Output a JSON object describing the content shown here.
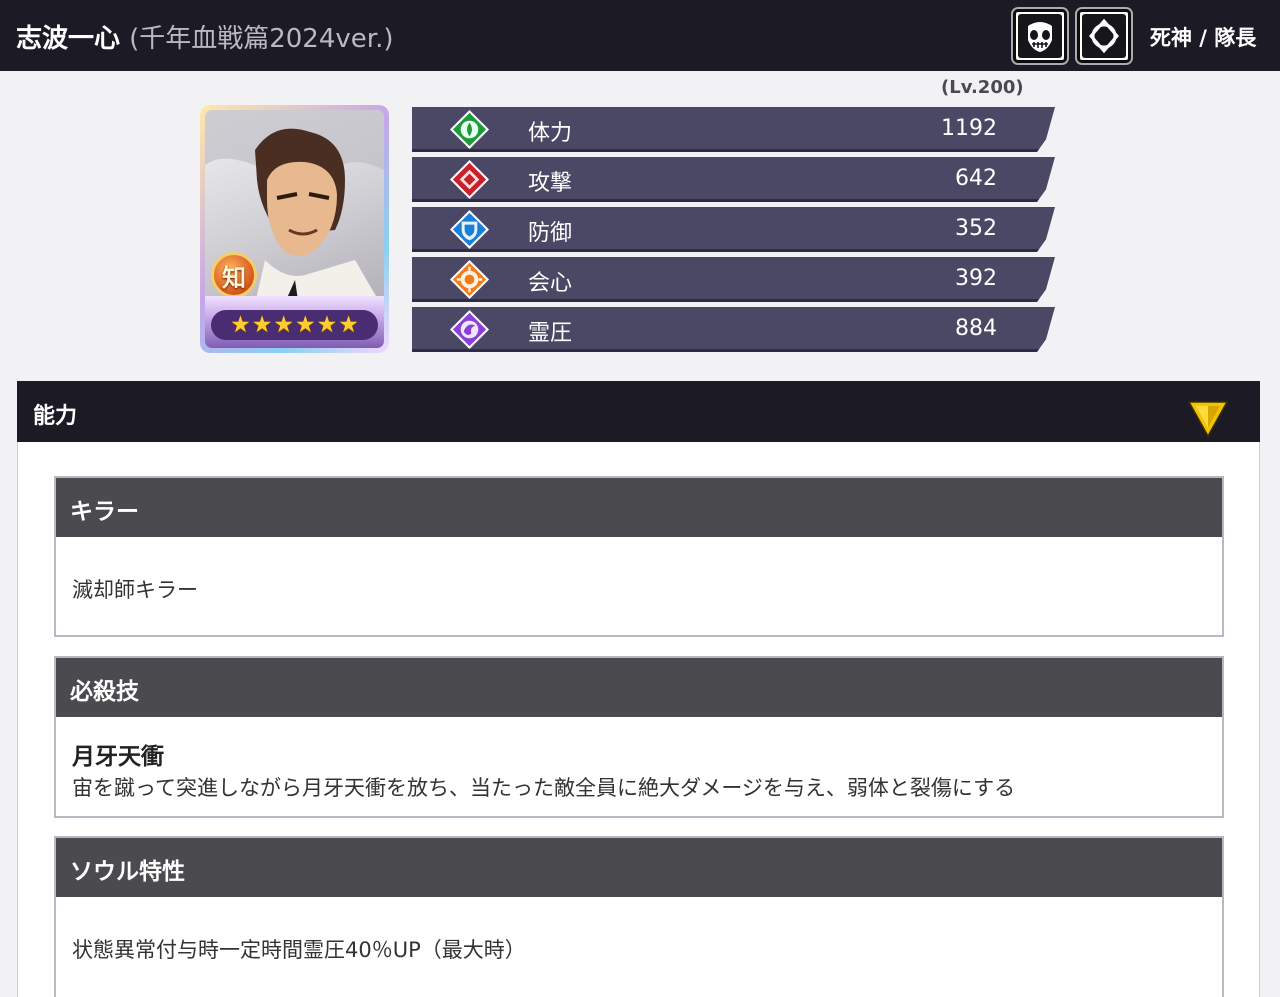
{
  "header": {
    "name": "志波一心",
    "subtitle": "(千年血戦篇2024ver.)",
    "class_label": "死神 / 隊長",
    "icons": [
      "hollow-mask-icon",
      "soul-ring-icon"
    ]
  },
  "portrait": {
    "attribute_badge": "知",
    "rarity_stars": 6,
    "stars_text": "★★★★★★"
  },
  "stats": {
    "level": "(Lv.200)",
    "rows": [
      {
        "label": "体力",
        "value": "1192",
        "icon": "hp-icon",
        "color": "#1f9a3a"
      },
      {
        "label": "攻撃",
        "value": "642",
        "icon": "attack-icon",
        "color": "#c9202a"
      },
      {
        "label": "防御",
        "value": "352",
        "icon": "defense-icon",
        "color": "#1c7fd6"
      },
      {
        "label": "会心",
        "value": "392",
        "icon": "critical-icon",
        "color": "#f07d1a"
      },
      {
        "label": "霊圧",
        "value": "884",
        "icon": "reiatsu-icon",
        "color": "#8a3fd6"
      }
    ]
  },
  "abilities": {
    "title": "能力",
    "killer": {
      "heading": "キラー",
      "text": "滅却師キラー"
    },
    "special": {
      "heading": "必殺技",
      "name": "月牙天衝",
      "text": "宙を蹴って突進しながら月牙天衝を放ち、当たった敵全員に絶大ダメージを与え、弱体と裂傷にする"
    },
    "soul_trait": {
      "heading": "ソウル特性",
      "text": "状態異常付与時一定時間霊圧40％UP（最大時）"
    }
  },
  "colors": {
    "header_bg": "#1b1a25",
    "stat_row_bg": "#4a4865",
    "card_head_bg": "#4b4b4f",
    "collapse_icon": "#f5c400"
  }
}
